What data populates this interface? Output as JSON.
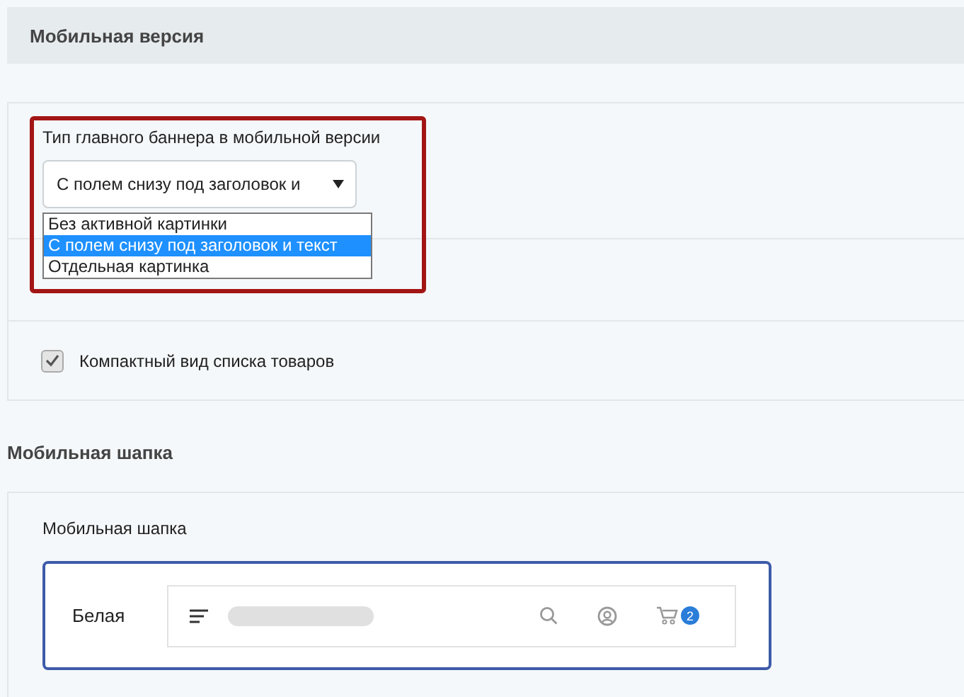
{
  "section_title": "Мобильная версия",
  "banner_select": {
    "label": "Тип главного баннера в мобильной версии",
    "value": "С полем снизу под заголовок и",
    "open": true,
    "highlighted": true,
    "options": [
      {
        "label": "Без активной картинки",
        "selected": false
      },
      {
        "label": "С полем снизу под заголовок и текст",
        "selected": true
      },
      {
        "label": "Отдельная картинка",
        "selected": false
      }
    ]
  },
  "compact_list": {
    "label": "Компактный вид списка товаров",
    "checked": true
  },
  "header_section_title": "Мобильная шапка",
  "header_setting": {
    "label": "Мобильная шапка",
    "variants": [
      {
        "label": "Белая",
        "selected": true,
        "cart_count": "2"
      }
    ]
  }
}
